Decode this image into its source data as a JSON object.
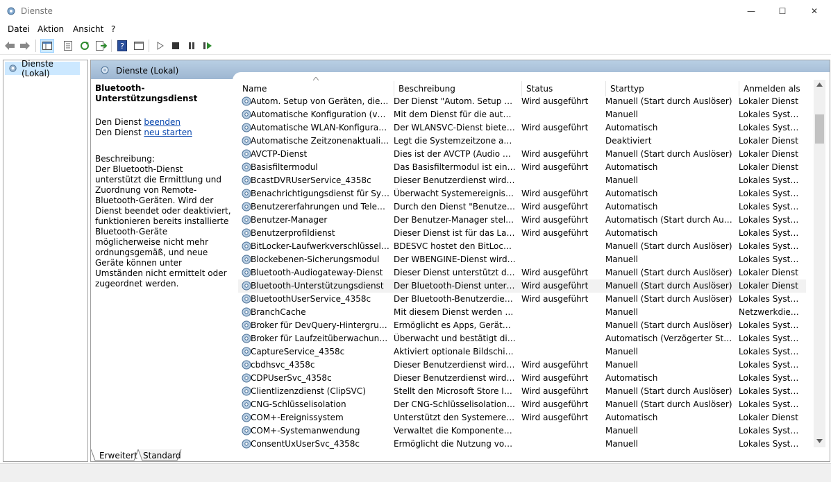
{
  "window": {
    "title": "Dienste",
    "minimize": "—",
    "maximize": "☐",
    "close": "✕"
  },
  "menu": [
    "Datei",
    "Aktion",
    "Ansicht",
    "?"
  ],
  "tree": {
    "root": "Dienste (Lokal)"
  },
  "header": {
    "title": "Dienste (Lokal)"
  },
  "detail": {
    "service_name": "Bluetooth-Unterstützungsdienst",
    "stop_prefix": "Den Dienst ",
    "stop_link": "beenden",
    "restart_prefix": "Den Dienst ",
    "restart_link": "neu starten",
    "description_label": "Beschreibung:",
    "description": "Der Bluetooth-Dienst unterstützt die Ermittlung und Zuordnung von Remote-Bluetooth-Geräten. Wird der Dienst beendet oder deaktiviert, funktionieren bereits installierte Bluetooth-Geräte möglicherweise nicht mehr ordnungsgemäß, und neue Geräte können unter Umständen nicht ermittelt oder zugeordnet werden."
  },
  "columns": [
    "Name",
    "Beschreibung",
    "Status",
    "Starttyp",
    "Anmelden als"
  ],
  "services": [
    [
      "Autom. Setup von Geräten, die mit ...",
      "Der Dienst \"Autom. Setup von ...",
      "Wird ausgeführt",
      "Manuell (Start durch Auslöser)",
      "Lokaler Dienst"
    ],
    [
      "Automatische Konfiguration (verka...",
      "Mit dem Dienst für die automa...",
      "",
      "Manuell",
      "Lokales System"
    ],
    [
      "Automatische WLAN-Konfiguration",
      "Der WLANSVC-Dienst bietet di...",
      "Wird ausgeführt",
      "Automatisch",
      "Lokales System"
    ],
    [
      "Automatische Zeitzonenaktualisieru...",
      "Legt die Systemzeitzone auto...",
      "",
      "Deaktiviert",
      "Lokaler Dienst"
    ],
    [
      "AVCTP-Dienst",
      "Dies ist der AVCTP (Audio Vide...",
      "Wird ausgeführt",
      "Manuell (Start durch Auslöser)",
      "Lokaler Dienst"
    ],
    [
      "Basisfiltermodul",
      "Das Basisfiltermodul ist ein Die...",
      "Wird ausgeführt",
      "Automatisch",
      "Lokaler Dienst"
    ],
    [
      "BcastDVRUserService_4358c",
      "Dieser Benutzerdienst wird für ...",
      "",
      "Manuell",
      "Lokales System"
    ],
    [
      "Benachrichtigungsdienst für System...",
      "Überwacht Systemereignisse u...",
      "Wird ausgeführt",
      "Automatisch",
      "Lokales System"
    ],
    [
      "Benutzererfahrungen und Telemetri...",
      "Durch den Dienst \"Benutzererf...",
      "Wird ausgeführt",
      "Automatisch",
      "Lokales System"
    ],
    [
      "Benutzer-Manager",
      "Der Benutzer-Manager stellt di...",
      "Wird ausgeführt",
      "Automatisch (Start durch Auslös...",
      "Lokales System"
    ],
    [
      "Benutzerprofildienst",
      "Dieser Dienst ist für das Laden ...",
      "Wird ausgeführt",
      "Automatisch",
      "Lokales System"
    ],
    [
      "BitLocker-Laufwerkverschlüsselung...",
      "BDESVC hostet den BitLocker-...",
      "",
      "Manuell (Start durch Auslöser)",
      "Lokales System"
    ],
    [
      "Blockebenen-Sicherungsmodul",
      "Der WBENGINE-Dienst wird vo...",
      "",
      "Manuell",
      "Lokales System"
    ],
    [
      "Bluetooth-Audiogateway-Dienst",
      "Dieser Dienst unterstützt die A...",
      "Wird ausgeführt",
      "Manuell (Start durch Auslöser)",
      "Lokaler Dienst"
    ],
    [
      "Bluetooth-Unterstützungsdienst",
      "Der Bluetooth-Dienst unterstüt...",
      "Wird ausgeführt",
      "Manuell (Start durch Auslöser)",
      "Lokaler Dienst"
    ],
    [
      "BluetoothUserService_4358c",
      "Der Bluetooth-Benutzerdienst ...",
      "Wird ausgeführt",
      "Manuell (Start durch Auslöser)",
      "Lokales System"
    ],
    [
      "BranchCache",
      "Mit diesem Dienst werden Net...",
      "",
      "Manuell",
      "Netzwerkdienst"
    ],
    [
      "Broker für DevQuery-Hintergrunder...",
      "Ermöglicht es Apps, Geräte mit...",
      "",
      "Manuell (Start durch Auslöser)",
      "Lokales System"
    ],
    [
      "Broker für Laufzeitüberwachung der...",
      "Überwacht und bestätigt die In...",
      "",
      "Automatisch (Verzögerter Start, ...",
      "Lokales System"
    ],
    [
      "CaptureService_4358c",
      "Aktiviert optionale Bildschirm-...",
      "",
      "Manuell",
      "Lokales System"
    ],
    [
      "cbdhsvc_4358c",
      "Dieser Benutzerdienst wird für ...",
      "Wird ausgeführt",
      "Manuell",
      "Lokales System"
    ],
    [
      "CDPUserSvc_4358c",
      "Dieser Benutzerdienst wird für ...",
      "Wird ausgeführt",
      "Automatisch",
      "Lokales System"
    ],
    [
      "Clientlizenzdienst (ClipSVC)",
      "Stellt den Microsoft Store Infr...",
      "Wird ausgeführt",
      "Manuell (Start durch Auslöser)",
      "Lokales System"
    ],
    [
      "CNG-Schlüsselisolation",
      "Der CNG-Schlüsselisolationsdi...",
      "Wird ausgeführt",
      "Manuell (Start durch Auslöser)",
      "Lokales System"
    ],
    [
      "COM+-Ereignissystem",
      "Unterstützt den Systemereignis...",
      "Wird ausgeführt",
      "Automatisch",
      "Lokaler Dienst"
    ],
    [
      "COM+-Systemanwendung",
      "Verwaltet die Komponentenko...",
      "",
      "Manuell",
      "Lokales System"
    ],
    [
      "ConsentUxUserSvc_4358c",
      "Ermöglicht die Nutzung von C...",
      "",
      "Manuell",
      "Lokales System"
    ]
  ],
  "selected_index": 14,
  "tabs": [
    "Erweitert",
    "Standard"
  ],
  "icons": [
    "gear-service-icon",
    "back-arrow-icon",
    "forward-arrow-icon",
    "console-tree-icon",
    "properties-icon",
    "refresh-icon",
    "export-icon",
    "help-icon",
    "view-icon",
    "play-icon",
    "stop-icon",
    "pause-icon",
    "resume-icon"
  ],
  "colors": {
    "header_gradient_top": "#b9cfe4",
    "header_gradient_bottom": "#9db6d1",
    "tree_selection": "#cce8ff",
    "link": "#0645ad",
    "row_selection": "#f2f2f2"
  }
}
